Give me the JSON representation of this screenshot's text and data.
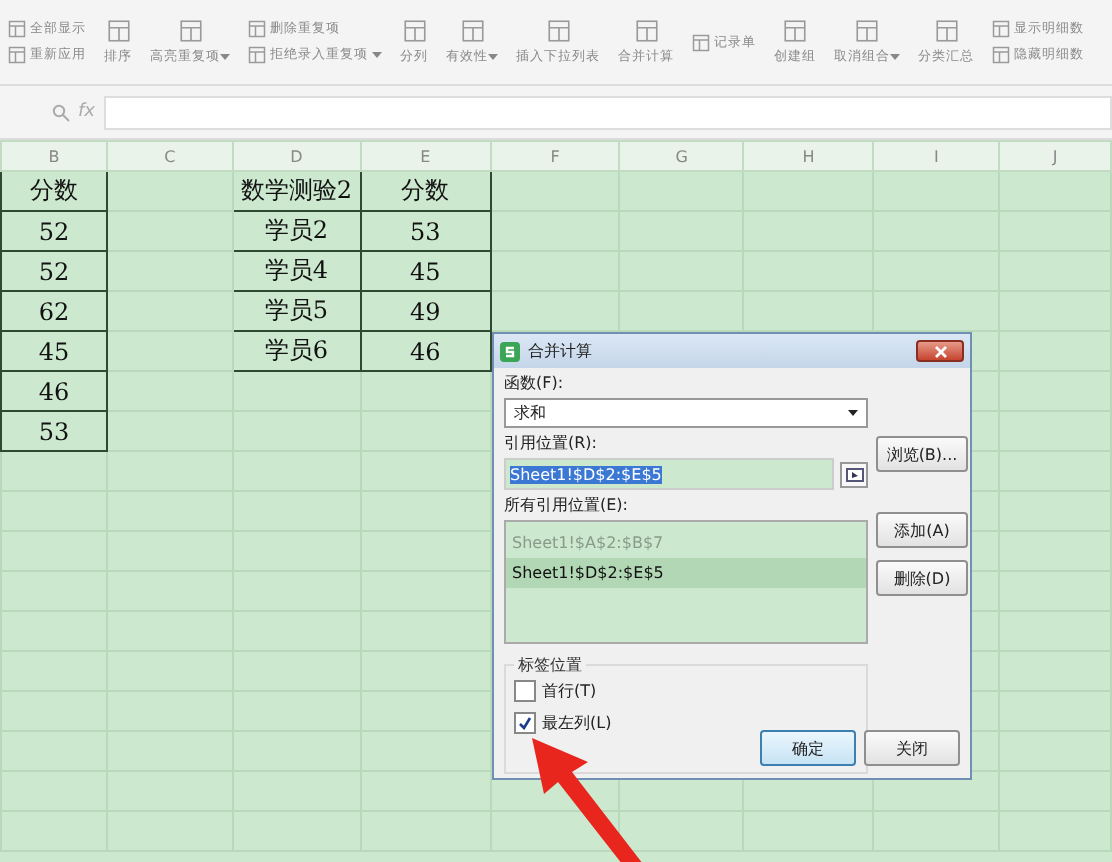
{
  "toolbar": {
    "items": [
      {
        "kind": "small",
        "label": "全部显示"
      },
      {
        "kind": "small",
        "label": "重新应用"
      },
      {
        "kind": "large",
        "label": "排序"
      },
      {
        "kind": "large",
        "label": "高亮重复项",
        "caret": true
      },
      {
        "kind": "small",
        "label": "删除重复项"
      },
      {
        "kind": "small",
        "label": "拒绝录入重复项",
        "caret": true
      },
      {
        "kind": "large",
        "label": "分列"
      },
      {
        "kind": "large",
        "label": "有效性",
        "caret": true
      },
      {
        "kind": "large",
        "label": "插入下拉列表"
      },
      {
        "kind": "large",
        "label": "合并计算"
      },
      {
        "kind": "small",
        "label": "记录单"
      },
      {
        "kind": "large",
        "label": "创建组"
      },
      {
        "kind": "large",
        "label": "取消组合",
        "caret": true
      },
      {
        "kind": "large",
        "label": "分类汇总"
      },
      {
        "kind": "small",
        "label": "显示明细数"
      },
      {
        "kind": "small",
        "label": "隐藏明细数"
      }
    ]
  },
  "formula_bar": {
    "fx": "fx"
  },
  "sheet": {
    "columns": [
      "B",
      "C",
      "D",
      "E",
      "F",
      "G",
      "H",
      "I",
      "J"
    ],
    "rows": [
      {
        "cells": [
          {
            "text": "分数",
            "bordered": true
          },
          {
            "text": "",
            "bordered": false
          },
          {
            "text": "数学测验2",
            "bordered": true
          },
          {
            "text": "分数",
            "bordered": true
          }
        ]
      },
      {
        "cells": [
          {
            "text": "52",
            "bordered": true
          },
          {
            "text": "",
            "bordered": false
          },
          {
            "text": "学员2",
            "bordered": true
          },
          {
            "text": "53",
            "bordered": true
          }
        ]
      },
      {
        "cells": [
          {
            "text": "52",
            "bordered": true
          },
          {
            "text": "",
            "bordered": false
          },
          {
            "text": "学员4",
            "bordered": true
          },
          {
            "text": "45",
            "bordered": true
          }
        ]
      },
      {
        "cells": [
          {
            "text": "62",
            "bordered": true
          },
          {
            "text": "",
            "bordered": false
          },
          {
            "text": "学员5",
            "bordered": true
          },
          {
            "text": "49",
            "bordered": true
          }
        ]
      },
      {
        "cells": [
          {
            "text": "45",
            "bordered": true
          },
          {
            "text": "",
            "bordered": false
          },
          {
            "text": "学员6",
            "bordered": true
          },
          {
            "text": "46",
            "bordered": true
          }
        ]
      },
      {
        "cells": [
          {
            "text": "46",
            "bordered": true
          }
        ]
      },
      {
        "cells": [
          {
            "text": "53",
            "bordered": true
          }
        ]
      }
    ]
  },
  "dialog": {
    "title": "合并计算",
    "function_label": "函数(F):",
    "function_value": "求和",
    "reference_label": "引用位置(R):",
    "reference_value": "Sheet1!$D$2:$E$5",
    "browse_button": "浏览(B)...",
    "all_references_label": "所有引用位置(E):",
    "references": [
      {
        "text": "Sheet1!$A$2:$B$7",
        "selected": false
      },
      {
        "text": "Sheet1!$D$2:$E$5",
        "selected": true
      }
    ],
    "add_button": "添加(A)",
    "delete_button": "删除(D)",
    "label_position_title": "标签位置",
    "options": [
      {
        "label": "首行(T)",
        "checked": false
      },
      {
        "label": "最左列(L)",
        "checked": true
      }
    ],
    "ok_button": "确定",
    "close_button": "关闭"
  }
}
